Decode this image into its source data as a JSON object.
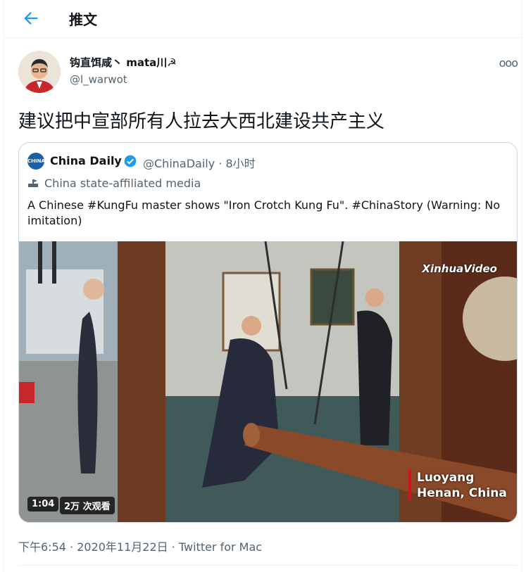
{
  "header": {
    "title": "推文"
  },
  "tweet": {
    "display_name": "钩直饵咸丶 mata川☭",
    "handle": "@l_warwot",
    "text": "建议把中宣部所有人拉去大西北建设共产主义",
    "more_label": "ooo",
    "timestamp": "下午6:54 · 2020年11月22日 · Twitter for Mac"
  },
  "quoted": {
    "logo_text": "CHINA DAILY",
    "display_name": "China Daily",
    "handle_time": "@ChinaDaily · 8小时",
    "label": "China state-affiliated media",
    "text": "A Chinese #KungFu master shows \"Iron Crotch Kung Fu\". #ChinaStory (Warning: No imitation)",
    "video": {
      "duration": "1:04",
      "views": "2万 次观看",
      "watermark": "XinhuaVideo",
      "location_line1": "Luoyang",
      "location_line2": "Henan, China"
    }
  },
  "colors": {
    "accent": "#1d9bf0",
    "secondary_text": "#536471",
    "border": "#cfd9de"
  }
}
